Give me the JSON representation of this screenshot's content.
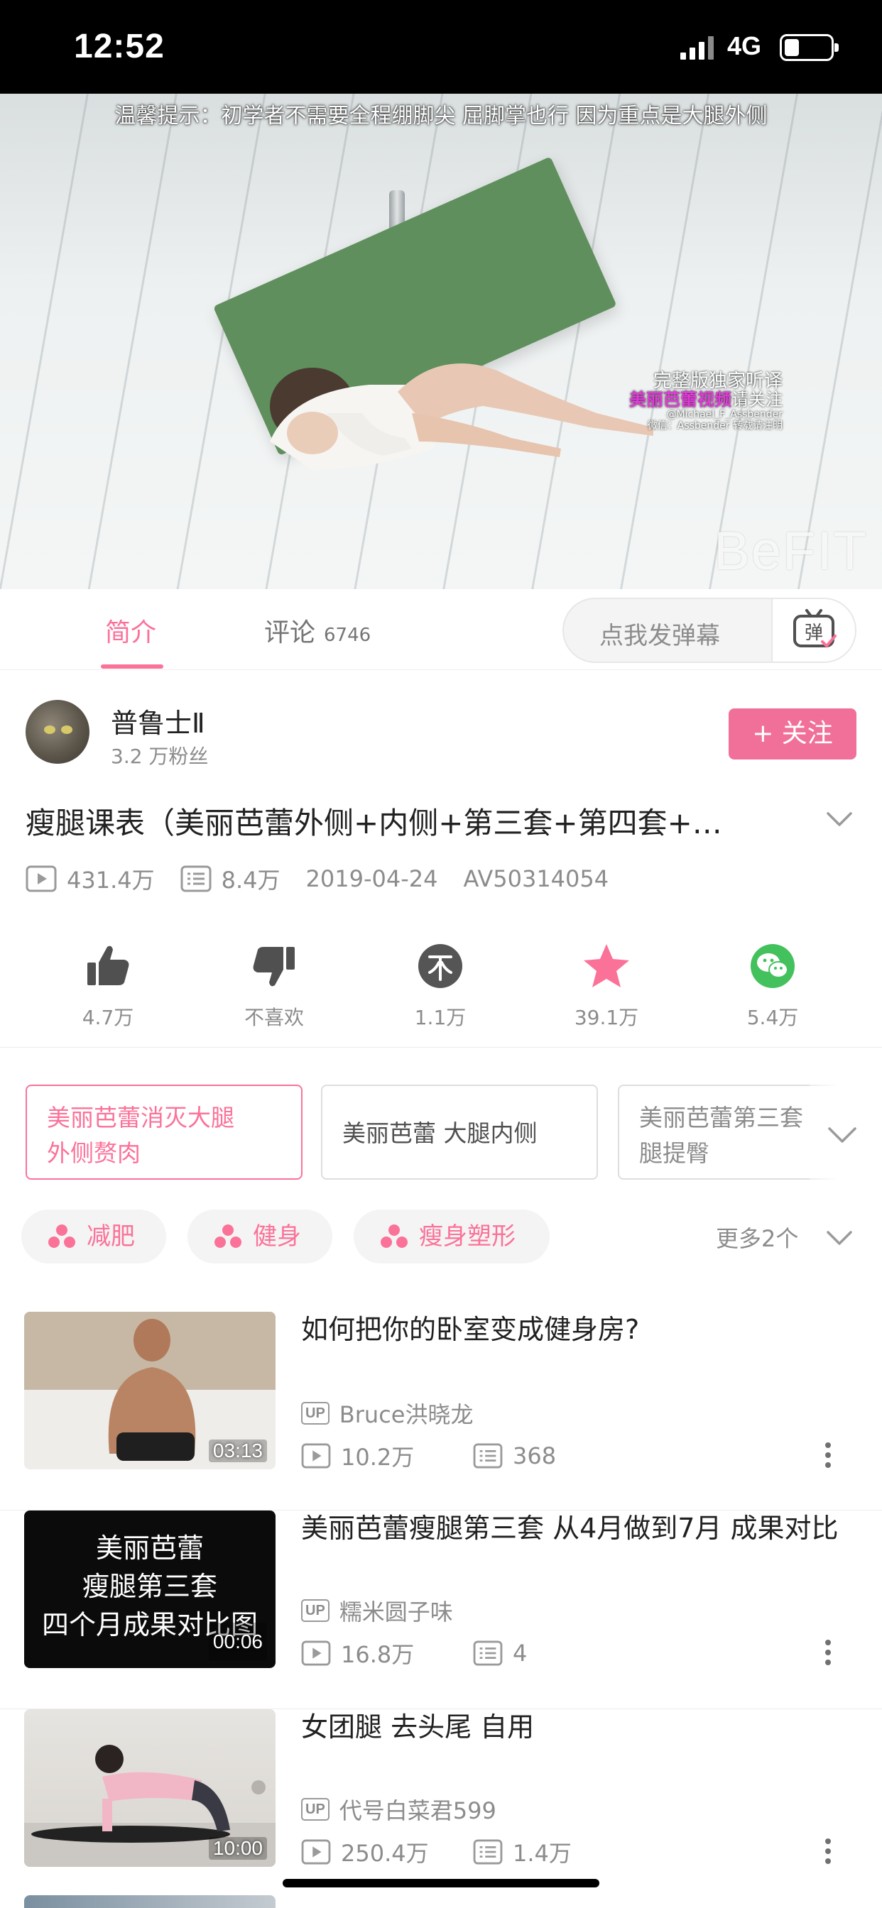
{
  "status_bar": {
    "time": "12:52",
    "network": "4G"
  },
  "video": {
    "caption_top": "温馨提示：初学者不需要全程绷脚尖 屈脚掌也行 因为重点是大腿外侧",
    "watermark_line1": "完整版独家听译",
    "watermark_line2": "美丽芭蕾视频",
    "watermark_line2_suffix": "请关注",
    "watermark_line3": "@Michael_F_Assbender",
    "watermark_line4": "微信：Assbender 转载请注明",
    "brand": "BeFIT"
  },
  "tabs": {
    "intro": "简介",
    "comments": "评论",
    "comments_count": "6746",
    "danmaku_placeholder": "点我发弹幕",
    "danmaku_button": "弹"
  },
  "uploader": {
    "name": "普鲁士Ⅱ",
    "fans": "3.2 万粉丝",
    "follow": "+ 关注"
  },
  "video_info": {
    "title": "瘦腿课表（美丽芭蕾外侧+内侧+第三套+第四套+…",
    "views": "431.4万",
    "danmaku": "8.4万",
    "date": "2019-04-24",
    "av": "AV50314054"
  },
  "actions": {
    "like": "4.7万",
    "dislike": "不喜欢",
    "coin": "1.1万",
    "favorite": "39.1万",
    "share": "5.4万"
  },
  "tag_cards": [
    {
      "line1": "美丽芭蕾消灭大腿",
      "line2": "外侧赘肉"
    },
    {
      "line1": "美丽芭蕾 大腿内侧",
      "line2": ""
    },
    {
      "line1": "美丽芭蕾第三套",
      "line2": "腿提臀"
    }
  ],
  "channels": {
    "items": [
      "减肥",
      "健身",
      "瘦身塑形"
    ],
    "more": "更多2个"
  },
  "related": [
    {
      "title": "如何把你的卧室变成健身房?",
      "up": "Bruce洪晓龙",
      "views": "10.2万",
      "danmaku": "368",
      "duration": "03:13",
      "thumb_text": ""
    },
    {
      "title": "美丽芭蕾瘦腿第三套  从4月做到7月  成果对比",
      "up": "糯米圆子味",
      "views": "16.8万",
      "danmaku": "4",
      "duration": "00:06",
      "thumb_text": "美丽芭蕾\n瘦腿第三套\n四个月成果对比图"
    },
    {
      "title": "女团腿  去头尾  自用",
      "up": "代号白菜君599",
      "views": "250.4万",
      "danmaku": "1.4万",
      "duration": "10:00",
      "thumb_text": ""
    }
  ],
  "up_badge": "UP",
  "colors": {
    "accent": "#fb7299",
    "follow_bg": "#f0709a",
    "share_green": "#43c15c",
    "coin_gray": "#555555",
    "icon_gray": "#505050"
  }
}
